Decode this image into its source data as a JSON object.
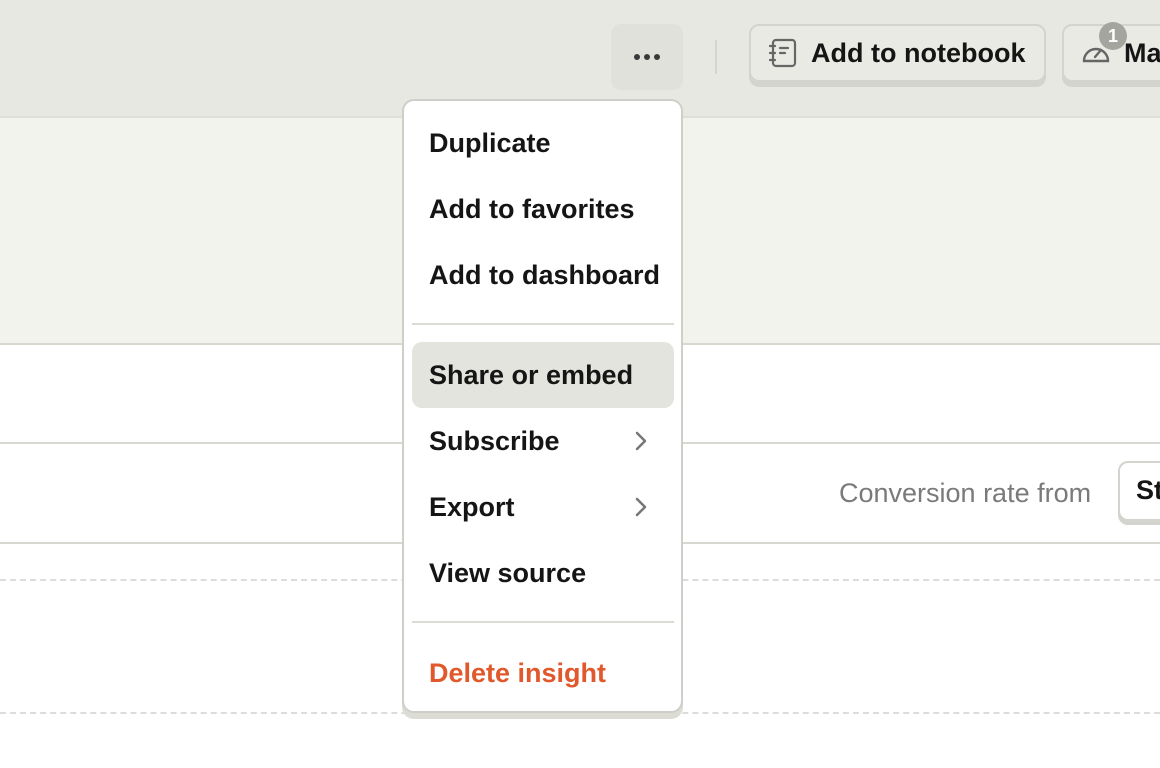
{
  "toolbar": {
    "more_icon": "more-horizontal-icon",
    "add_to_notebook": {
      "label": "Add to notebook",
      "icon": "notebook-icon"
    },
    "mark_reviewed": {
      "label": "Ma",
      "icon": "gauge-icon",
      "badge": "1"
    }
  },
  "content": {
    "conversion_label": "Conversion rate from",
    "conversion_select_value": "St"
  },
  "menu": {
    "items": [
      {
        "label": "Duplicate"
      },
      {
        "label": "Add to favorites"
      },
      {
        "label": "Add to dashboard"
      },
      {
        "label": "Share or embed",
        "active": true
      },
      {
        "label": "Subscribe",
        "submenu": true
      },
      {
        "label": "Export",
        "submenu": true
      },
      {
        "label": "View source"
      },
      {
        "label": "Delete insight",
        "danger": true
      }
    ]
  },
  "colors": {
    "danger": "#e0582b",
    "active_bg": "#e4e4de",
    "toolbar_bg": "#e8e8e2",
    "band_bg": "#f3f3ee"
  }
}
